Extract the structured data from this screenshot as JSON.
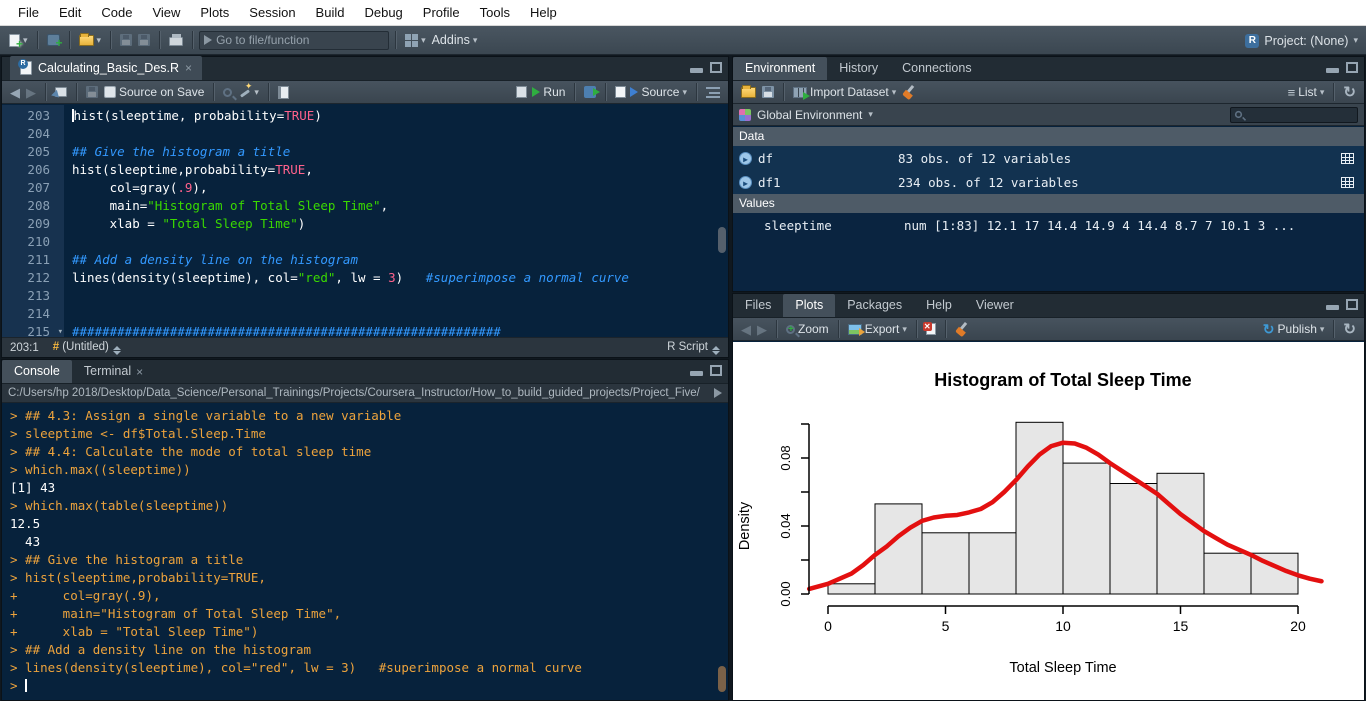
{
  "window": {
    "project_label": "Project: (None)"
  },
  "menubar": {
    "items": [
      "File",
      "Edit",
      "Code",
      "View",
      "Plots",
      "Session",
      "Build",
      "Debug",
      "Profile",
      "Tools",
      "Help"
    ]
  },
  "main_toolbar": {
    "goto_placeholder": "Go to file/function",
    "addins_label": "Addins"
  },
  "source_pane": {
    "tab_title": "Calculating_Basic_Des.R",
    "toolbar": {
      "source_on_save": "Source on Save",
      "run_label": "Run",
      "source_label": "Source"
    },
    "status": {
      "position": "203:1",
      "section": "(Untitled)",
      "doc_type": "R Script"
    },
    "editor": {
      "lines": [
        {
          "n": 203,
          "cursor": true,
          "tokens": [
            {
              "t": "hist(sleeptime, probability="
            },
            {
              "t": "TRUE",
              "c": "num"
            },
            {
              "t": ")"
            }
          ]
        },
        {
          "n": 204,
          "tokens": []
        },
        {
          "n": 205,
          "tokens": [
            {
              "t": "## Give the histogram a title",
              "c": "com"
            }
          ]
        },
        {
          "n": 206,
          "tokens": [
            {
              "t": "hist(sleeptime,probability="
            },
            {
              "t": "TRUE",
              "c": "num"
            },
            {
              "t": ","
            }
          ]
        },
        {
          "n": 207,
          "tokens": [
            {
              "t": "     col=gray("
            },
            {
              "t": ".9",
              "c": "num"
            },
            {
              "t": "),"
            }
          ]
        },
        {
          "n": 208,
          "tokens": [
            {
              "t": "     main="
            },
            {
              "t": "\"Histogram of Total Sleep Time\"",
              "c": "str"
            },
            {
              "t": ","
            }
          ]
        },
        {
          "n": 209,
          "tokens": [
            {
              "t": "     xlab = "
            },
            {
              "t": "\"Total Sleep Time\"",
              "c": "str"
            },
            {
              "t": ")"
            }
          ]
        },
        {
          "n": 210,
          "tokens": []
        },
        {
          "n": 211,
          "tokens": [
            {
              "t": "## Add a density line on the histogram",
              "c": "com"
            }
          ]
        },
        {
          "n": 212,
          "tokens": [
            {
              "t": "lines(density(sleeptime), col="
            },
            {
              "t": "\"red\"",
              "c": "str"
            },
            {
              "t": ", lw = "
            },
            {
              "t": "3",
              "c": "num"
            },
            {
              "t": ")   "
            },
            {
              "t": "#superimpose a normal curve",
              "c": "com"
            }
          ]
        },
        {
          "n": 213,
          "tokens": []
        },
        {
          "n": 214,
          "tokens": []
        },
        {
          "n": 215,
          "fold": true,
          "tokens": [
            {
              "t": "#########################################################",
              "c": "com"
            }
          ]
        }
      ]
    }
  },
  "console_pane": {
    "tabs": [
      "Console",
      "Terminal"
    ],
    "path": "C:/Users/hp 2018/Desktop/Data_Science/Personal_Trainings/Projects/Coursera_Instructor/How_to_build_guided_projects/Project_Five/",
    "lines": [
      {
        "text": "> ## 4.3: Assign a single variable to a new variable",
        "kind": "in"
      },
      {
        "text": "> sleeptime <- df$Total.Sleep.Time",
        "kind": "in"
      },
      {
        "text": "> ## 4.4: Calculate the mode of total sleep time",
        "kind": "in"
      },
      {
        "text": "> which.max((sleeptime))",
        "kind": "in"
      },
      {
        "text": "[1] 43",
        "kind": "out"
      },
      {
        "text": "> which.max(table(sleeptime))",
        "kind": "in"
      },
      {
        "text": "12.5",
        "kind": "out"
      },
      {
        "text": "  43",
        "kind": "out"
      },
      {
        "text": "> ## Give the histogram a title",
        "kind": "in"
      },
      {
        "text": "> hist(sleeptime,probability=TRUE,",
        "kind": "in"
      },
      {
        "text": "+      col=gray(.9),",
        "kind": "in"
      },
      {
        "text": "+      main=\"Histogram of Total Sleep Time\",",
        "kind": "in"
      },
      {
        "text": "+      xlab = \"Total Sleep Time\")",
        "kind": "in"
      },
      {
        "text": "> ## Add a density line on the histogram",
        "kind": "in"
      },
      {
        "text": "> lines(density(sleeptime), col=\"red\", lw = 3)   #superimpose a normal curve",
        "kind": "in"
      },
      {
        "text": "> ",
        "kind": "in",
        "cursor": true
      }
    ]
  },
  "environment_pane": {
    "tabs": [
      "Environment",
      "History",
      "Connections"
    ],
    "toolbar": {
      "import_label": "Import Dataset",
      "list_label": "List"
    },
    "scope_label": "Global Environment",
    "sections": [
      {
        "header": "Data",
        "rows": [
          {
            "name": "df",
            "value": "83 obs. of 12 variables",
            "expandable": true,
            "grid": true
          },
          {
            "name": "df1",
            "value": "234 obs. of 12 variables",
            "expandable": true,
            "grid": true
          }
        ]
      },
      {
        "header": "Values",
        "rows": [
          {
            "name": "sleeptime",
            "value": "num [1:83] 12.1 17 14.4 14.9 4 14.4 8.7 7 10.1 3 ...",
            "expandable": false,
            "grid": false
          }
        ]
      }
    ]
  },
  "plots_pane": {
    "tabs": [
      "Files",
      "Plots",
      "Packages",
      "Help",
      "Viewer"
    ],
    "toolbar": {
      "zoom_label": "Zoom",
      "export_label": "Export",
      "publish_label": "Publish"
    }
  },
  "chart_data": {
    "type": "bar",
    "subtype": "histogram-with-density-line",
    "title": "Histogram of Total Sleep Time",
    "xlabel": "Total Sleep Time",
    "ylabel": "Density",
    "bin_start": 0,
    "bin_width": 2,
    "bin_densities": [
      0.006,
      0.053,
      0.036,
      0.036,
      0.101,
      0.077,
      0.065,
      0.071,
      0.024,
      0.024
    ],
    "x_ticks": [
      0,
      5,
      10,
      15,
      20
    ],
    "y_ticks_labeled": [
      0.0,
      0.04,
      0.08
    ],
    "y_tick_step": 0.02,
    "y_axis_max": 0.1,
    "xlim": [
      0,
      21
    ],
    "grid": false,
    "bar_fill": "#e6e6e6",
    "bar_stroke": "#000000",
    "density_color": "#e31010",
    "density_curve": {
      "x": [
        -0.8,
        0,
        0.5,
        1,
        1.5,
        2,
        2.5,
        3,
        3.5,
        4,
        4.5,
        5,
        5.5,
        6,
        6.5,
        7,
        7.5,
        8,
        8.5,
        9,
        9.5,
        10,
        10.5,
        11,
        11.5,
        12,
        12.5,
        13,
        13.5,
        14,
        14.5,
        15,
        15.5,
        16,
        16.5,
        17,
        17.5,
        18,
        18.5,
        19,
        19.5,
        20,
        20.5,
        21
      ],
      "y": [
        0.003,
        0.006,
        0.009,
        0.012,
        0.017,
        0.023,
        0.028,
        0.034,
        0.039,
        0.043,
        0.045,
        0.046,
        0.0465,
        0.048,
        0.05,
        0.054,
        0.06,
        0.067,
        0.075,
        0.082,
        0.087,
        0.089,
        0.0885,
        0.086,
        0.082,
        0.077,
        0.0725,
        0.068,
        0.0635,
        0.059,
        0.053,
        0.047,
        0.042,
        0.037,
        0.033,
        0.029,
        0.026,
        0.023,
        0.0195,
        0.0165,
        0.0135,
        0.011,
        0.009,
        0.0075
      ]
    }
  },
  "colors": {
    "editor_bg": "#07223c",
    "gutter_bg": "#17324f",
    "console_input": "#eda33c",
    "comment_blue": "#3399ff",
    "string_green": "#3ad900",
    "number_pink": "#ff628c",
    "toolbar_gray": "#3f4b56",
    "menu_bg": "#ffffff"
  }
}
